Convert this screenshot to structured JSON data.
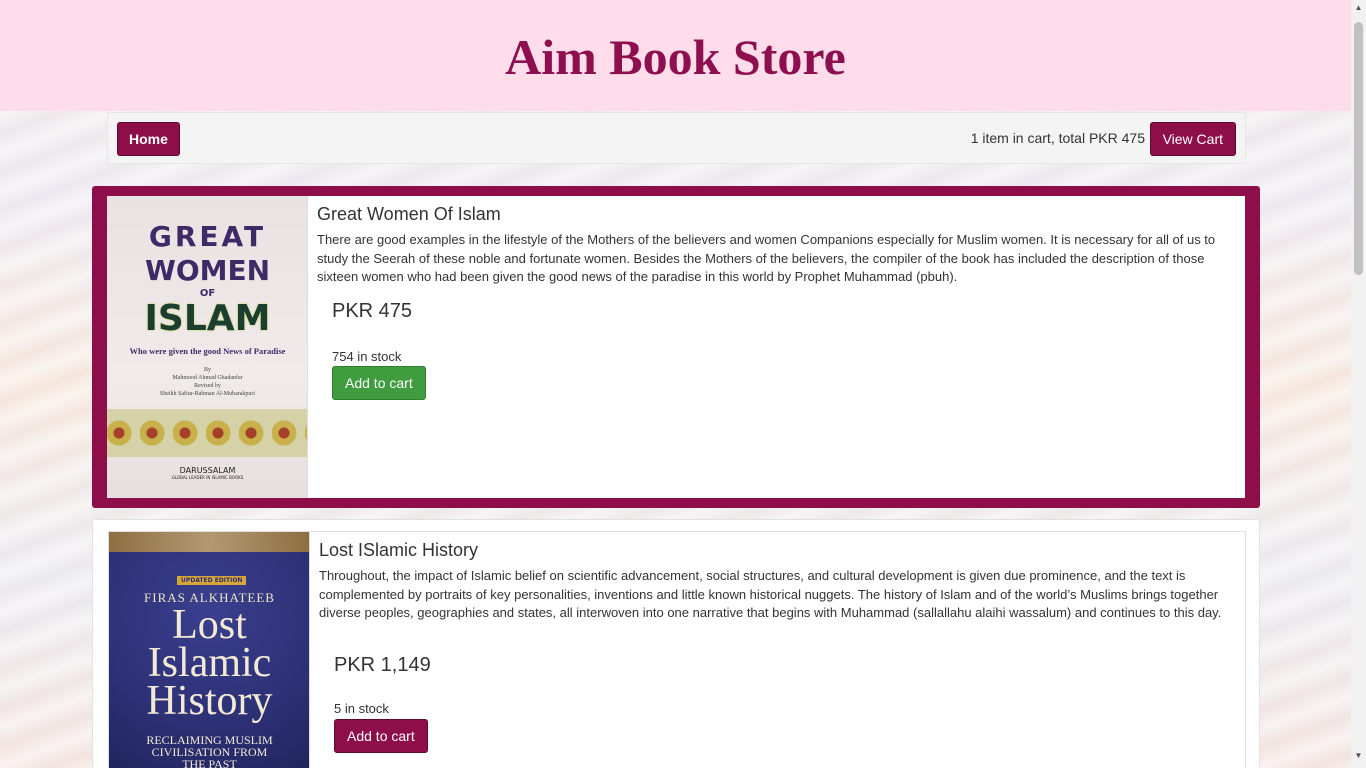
{
  "header": {
    "title": "Aim Book Store"
  },
  "navbar": {
    "home_label": "Home",
    "cart_summary": "1 item in cart, total PKR 475",
    "view_cart_label": "View Cart"
  },
  "products": [
    {
      "title": "Great Women Of Islam",
      "description": "There are good examples in the lifestyle of the Mothers of the believers and women Companions especially for Muslim women. It is necessary for all of us to study the Seerah of these noble and fortunate women. Besides the Mothers of the believers, the compiler of the book has included the description of those sixteen women who had been given the good news of the paradise in this world by Prophet Muhammad (pbuh).",
      "price": "PKR 475",
      "stock": "754 in stock",
      "add_label": "Add to cart",
      "cover": {
        "line1": "GREAT",
        "line2": "WOMEN",
        "line3": "OF",
        "line4": "ISLAM",
        "subtitle": "Who were given the good News of Paradise",
        "by": "By",
        "author": "Mahmood Ahmad Ghadanfar",
        "revised_by": "Revised by",
        "reviser": "Sheikh Safiur-Rahman Al-Mubarakpuri",
        "publisher": "DARUSSALAM",
        "publisher_tag": "GLOBAL LEADER IN ISLAMIC BOOKS"
      }
    },
    {
      "title": "Lost ISlamic History",
      "description": "Throughout, the impact of Islamic belief on scientific advancement, social structures, and cultural development is given due prominence, and the text is complemented by portraits of key personalities, inventions and little known historical nuggets. The history of Islam and of the world’s Muslims brings together diverse peoples, geographies and states, all interwoven into one narrative that begins with Muhammad (sallallahu alaihi wassalum) and continues to this day.",
      "price": "PKR 1,149",
      "stock": "5 in stock",
      "add_label": "Add to cart",
      "cover": {
        "edition": "UPDATED EDITION",
        "author": "FIRAS ALKHATEEB",
        "title_line1": "Lost",
        "title_line2": "Islamic",
        "title_line3": "History",
        "subtitle_line1": "RECLAIMING MUSLIM",
        "subtitle_line2": "CIVILISATION FROM",
        "subtitle_line3": "THE PAST"
      }
    }
  ],
  "colors": {
    "header_bg": "#ffdce9",
    "brand": "#8e0e4a",
    "add_green": "#3f9c3f"
  }
}
